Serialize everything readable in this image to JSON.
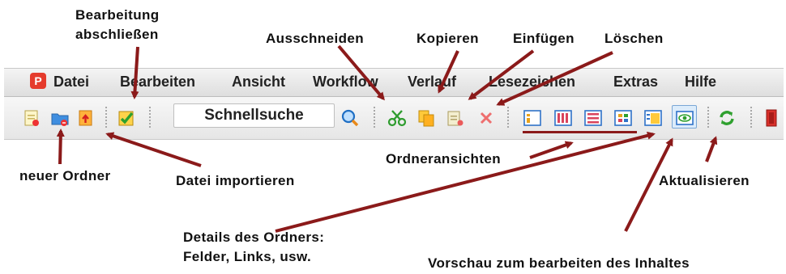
{
  "menu": {
    "items": [
      "Datei",
      "Bearbeiten",
      "Ansicht",
      "Workflow",
      "Verlauf",
      "Lesezeichen",
      "Extras",
      "Hilfe"
    ],
    "logo_text": "P"
  },
  "toolbar": {
    "search_label": "Schnellsuche",
    "icons": [
      "new-file-icon",
      "new-folder-icon",
      "import-file-icon",
      "finish-edit-icon",
      "search-icon",
      "cut-icon",
      "copy-icon",
      "paste-icon",
      "delete-icon",
      "folder-view-1-icon",
      "folder-view-2-icon",
      "folder-view-3-icon",
      "folder-view-4-icon",
      "folder-details-icon",
      "preview-icon",
      "refresh-icon",
      "exit-icon"
    ]
  },
  "annotations": {
    "finish_edit_line1": "Bearbeitung",
    "finish_edit_line2": "abschließen",
    "cut": "Ausschneiden",
    "copy": "Kopieren",
    "paste": "Einfügen",
    "delete": "Löschen",
    "new_folder": "neuer Ordner",
    "import_file": "Datei importieren",
    "folder_views": "Ordneransichten",
    "refresh": "Aktualisieren",
    "details_line1": "Details des Ordners:",
    "details_line2": "Felder, Links, usw.",
    "preview": "Vorschau zum bearbeiten des Inhaltes"
  },
  "colors": {
    "arrow": "#8b1a1a",
    "logo": "#e53b2c"
  }
}
